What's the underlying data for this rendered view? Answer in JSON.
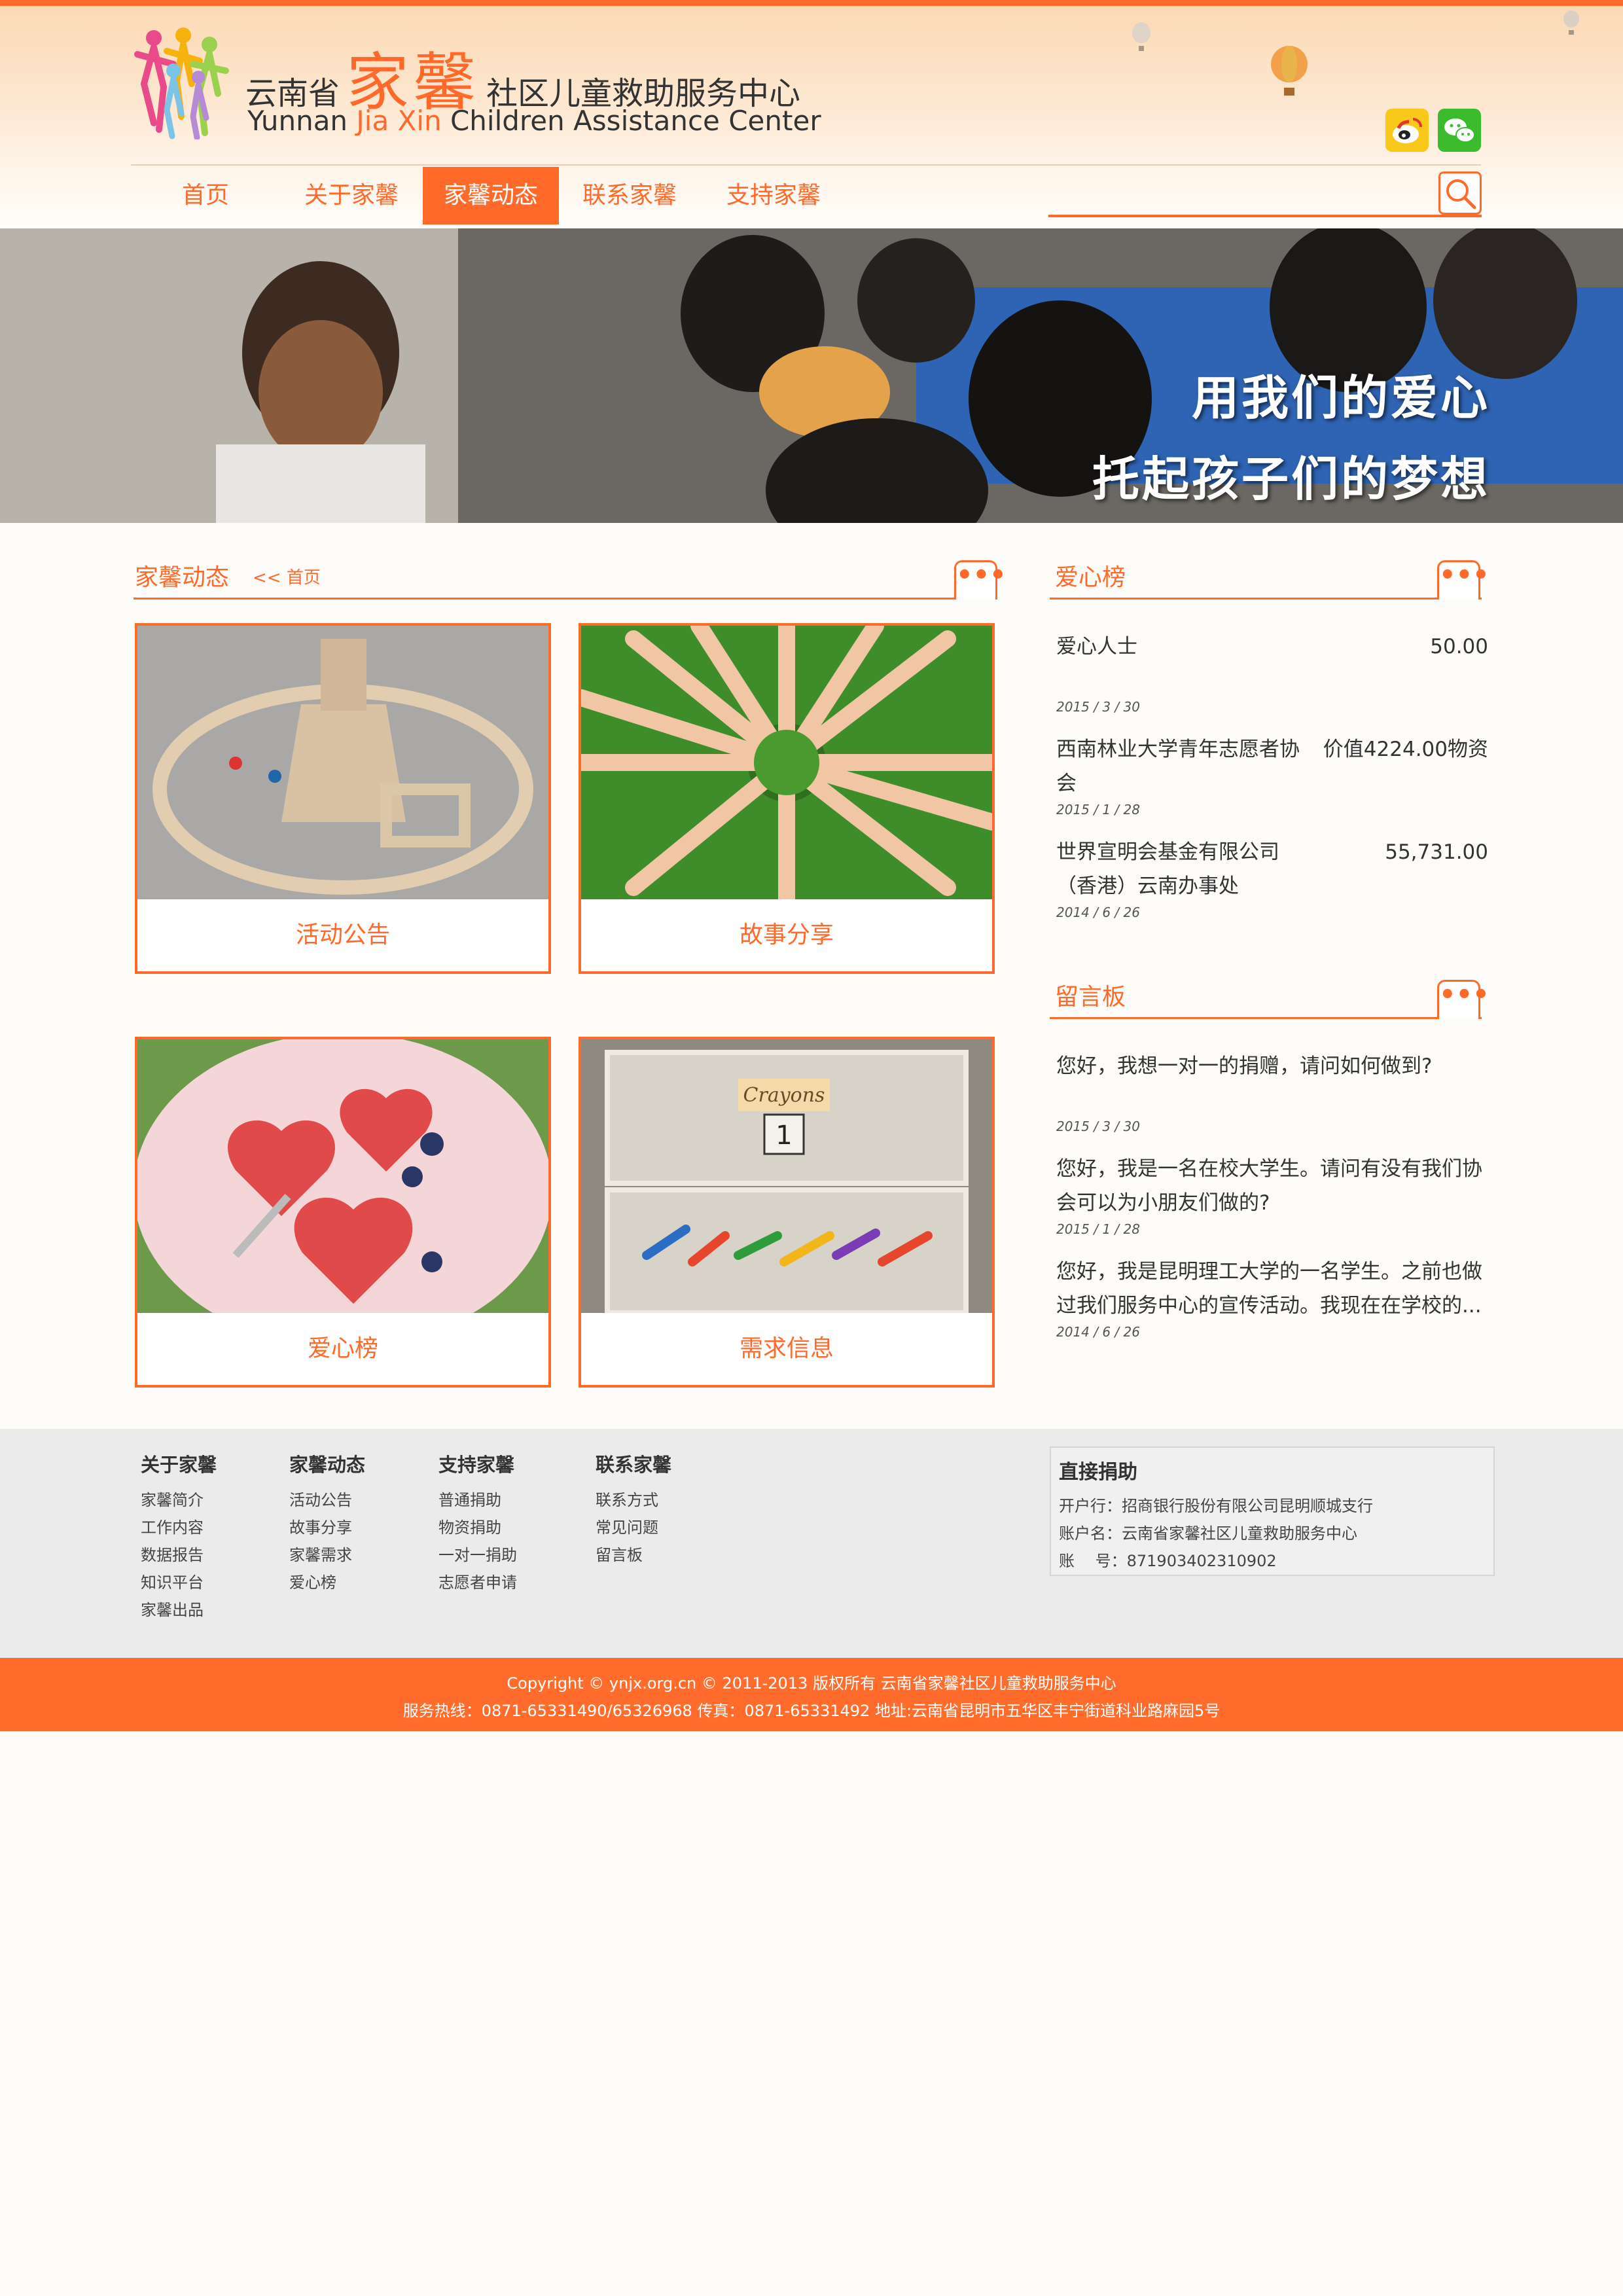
{
  "brand": {
    "cn_prefix": "云南省",
    "cn_name": "家馨",
    "cn_suffix": "社区儿童救助服务中心",
    "en_prefix": "Yunnan ",
    "en_highlight": "Jia Xin",
    "en_suffix": " Children Assistance Center",
    "accent_color": "#ff6a2a"
  },
  "social": {
    "weibo_icon": "weibo-icon",
    "wechat_icon": "wechat-icon"
  },
  "nav": {
    "items": [
      {
        "label": "首页"
      },
      {
        "label": "关于家馨"
      },
      {
        "label": "家馨动态",
        "active": true
      },
      {
        "label": "联系家馨"
      },
      {
        "label": "支持家馨"
      }
    ]
  },
  "search": {
    "placeholder": "",
    "icon": "search-icon"
  },
  "banner": {
    "line1": "用我们的爱心",
    "line2": "托起孩子们的梦想"
  },
  "news": {
    "title": "家馨动态",
    "breadcrumb": "<<  首页",
    "more": "•••",
    "cards": [
      {
        "label": "活动公告"
      },
      {
        "label": "故事分享"
      },
      {
        "label": "爱心榜"
      },
      {
        "label": "需求信息"
      }
    ]
  },
  "love_board": {
    "title": "爱心榜",
    "more": "•••",
    "items": [
      {
        "name": "爱心人士",
        "amount": "50.00",
        "date": "2015 / 3 / 30"
      },
      {
        "name": "西南林业大学青年志愿者协会",
        "amount": "价值4224.00物资",
        "date": "2015 / 1 / 28"
      },
      {
        "name": "世界宣明会基金有限公司（香港）云南办事处",
        "amount": "55,731.00",
        "date": "2014 / 6 / 26"
      }
    ]
  },
  "message_board": {
    "title": "留言板",
    "more": "•••",
    "items": [
      {
        "text": "您好，我想一对一的捐赠，请问如何做到?",
        "date": "2015 / 3 / 30"
      },
      {
        "text": "您好，我是一名在校大学生。请问有没有我们协会可以为小朋友们做的?",
        "date": "2015 / 1 / 28"
      },
      {
        "text": "您好，我是昆明理工大学的一名学生。之前也做过我们服务中心的宣传活动。我现在在学校的...",
        "date": "2014 / 6 / 26"
      }
    ]
  },
  "footer": {
    "columns": [
      {
        "title": "关于家馨",
        "links": [
          "家馨简介",
          "工作内容",
          "数据报告",
          "知识平台",
          "家馨出品"
        ]
      },
      {
        "title": "家馨动态",
        "links": [
          "活动公告",
          "故事分享",
          "家馨需求",
          "爱心榜"
        ]
      },
      {
        "title": "支持家馨",
        "links": [
          "普通捐助",
          "物资捐助",
          "一对一捐助",
          "志愿者申请"
        ]
      },
      {
        "title": "联系家馨",
        "links": [
          "联系方式",
          "常见问题",
          "留言板"
        ]
      }
    ],
    "donate": {
      "title": "直接捐助",
      "bank": "开户行：招商银行股份有限公司昆明顺城支行",
      "account_name": "账户名：云南省家馨社区儿童救助服务中心",
      "account_no": "账　 号：871903402310902"
    }
  },
  "copyright": {
    "line1": "Copyright © ynjx.org.cn © 2011-2013 版权所有 云南省家馨社区儿童救助服务中心",
    "line2": "服务热线：0871-65331490/65326968 传真：0871-65331492 地址:云南省昆明市五华区丰宁街道科业路麻园5号"
  }
}
